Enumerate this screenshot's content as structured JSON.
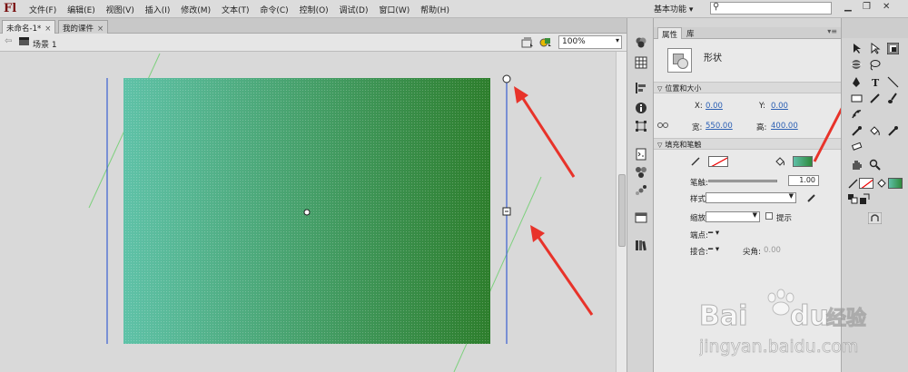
{
  "app": {
    "logo": "Fl",
    "menu": [
      "文件(F)",
      "编辑(E)",
      "视图(V)",
      "插入(I)",
      "修改(M)",
      "文本(T)",
      "命令(C)",
      "控制(O)",
      "调试(D)",
      "窗口(W)",
      "帮助(H)"
    ],
    "workspace_label": "基本功能",
    "search_placeholder": ""
  },
  "tabs": [
    {
      "label": "未命名-1*",
      "close": "×"
    },
    {
      "label": "我的课件",
      "close": "×"
    }
  ],
  "scene": {
    "back_arrow": "⇦",
    "name": "场景 1",
    "zoom": "100%"
  },
  "properties": {
    "tabs": [
      "属性",
      "库"
    ],
    "object_type": "形状",
    "pos_size_section": "位置和大小",
    "x_label": "X:",
    "x_value": "0.00",
    "y_label": "Y:",
    "y_value": "0.00",
    "width_label": "宽:",
    "width_value": "550.00",
    "height_label": "高:",
    "height_value": "400.00",
    "fill_stroke_section": "填充和笔触",
    "stroke_label": "笔触:",
    "stroke_value": "1.00",
    "style_label": "样式:",
    "scale_label": "缩放:",
    "hint_label": "提示",
    "cap_label": "端点:",
    "join_label": "接合:",
    "miter_label": "尖角:",
    "miter_value": "0.00"
  },
  "canvas": {
    "fill_gradient_start": "#5fc2a8",
    "fill_gradient_end": "#2d7e2c"
  },
  "annotation_color": "#e8332a",
  "watermark": {
    "brand": "Bai",
    "brand2": "du",
    "cn": "经验",
    "url": "jingyan.baidu.com"
  }
}
